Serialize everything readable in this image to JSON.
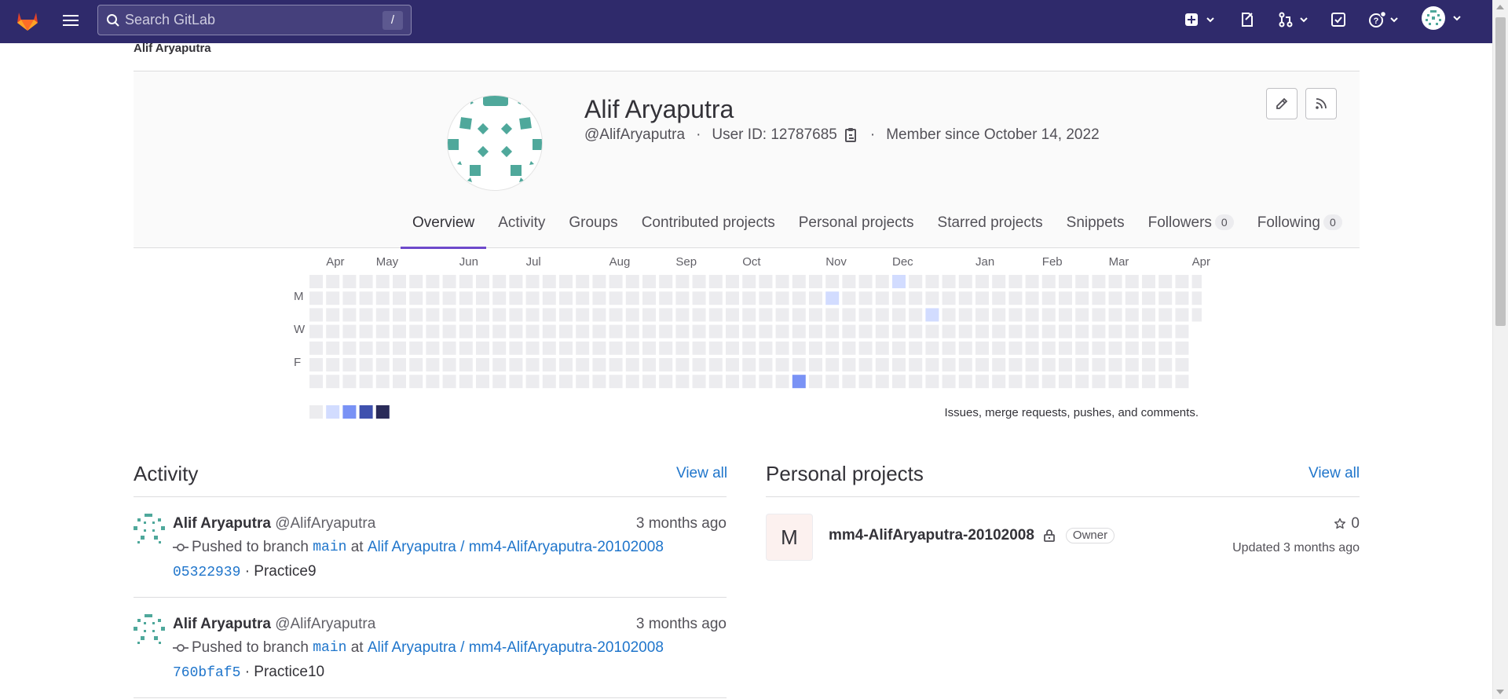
{
  "topbar": {
    "search_placeholder": "Search GitLab",
    "search_shortcut": "/",
    "colors": {
      "background": "#2f2a6b",
      "search_bg": "#45407c"
    }
  },
  "breadcrumb": "Alif Aryaputra",
  "profile": {
    "name": "Alif Aryaputra",
    "username": "@AlifAryaputra",
    "user_id": "User ID: 12787685",
    "member_since": "Member since October 14, 2022",
    "separator": "·"
  },
  "tabs": [
    {
      "label": "Overview",
      "active": true
    },
    {
      "label": "Activity"
    },
    {
      "label": "Groups"
    },
    {
      "label": "Contributed projects"
    },
    {
      "label": "Personal projects"
    },
    {
      "label": "Starred projects"
    },
    {
      "label": "Snippets"
    },
    {
      "label": "Followers",
      "count": "0"
    },
    {
      "label": "Following",
      "count": "0"
    }
  ],
  "calendar": {
    "months": [
      "Apr",
      "May",
      "Jun",
      "Jul",
      "Aug",
      "Sep",
      "Oct",
      "Nov",
      "Dec",
      "Jan",
      "Feb",
      "Mar",
      "Apr"
    ],
    "day_labels": [
      "M",
      "W",
      "F"
    ],
    "legend_text": "Issues, merge requests, pushes, and comments.",
    "colors": {
      "empty": "#ececef",
      "level1": "#d2dcff",
      "level2": "#7992f5",
      "level3": "#3f51ae",
      "level4": "#2a2b59"
    },
    "contributions": [
      {
        "week": 35,
        "day": 0,
        "level": 1
      },
      {
        "week": 31,
        "day": 1,
        "level": 1
      },
      {
        "week": 37,
        "day": 2,
        "level": 1
      },
      {
        "week": 29,
        "day": 6,
        "level": 2
      }
    ]
  },
  "activity": {
    "title": "Activity",
    "view_all": "View all",
    "events": [
      {
        "author": "Alif Aryaputra",
        "handle": "@AlifAryaputra",
        "time": "3 months ago",
        "action": "Pushed to branch",
        "branch": "main",
        "at": "at",
        "project": "Alif Aryaputra / mm4-AlifAryaputra-20102008",
        "commit": "05322939",
        "message": "· Practice9"
      },
      {
        "author": "Alif Aryaputra",
        "handle": "@AlifAryaputra",
        "time": "3 months ago",
        "action": "Pushed to branch",
        "branch": "main",
        "at": "at",
        "project": "Alif Aryaputra / mm4-AlifAryaputra-20102008",
        "commit": "760bfaf5",
        "message": "· Practice10"
      }
    ]
  },
  "personal_projects": {
    "title": "Personal projects",
    "view_all": "View all",
    "items": [
      {
        "initial": "M",
        "name": "mm4-AlifAryaputra-20102008",
        "role": "Owner",
        "stars": "0",
        "updated": "Updated 3 months ago"
      }
    ]
  }
}
